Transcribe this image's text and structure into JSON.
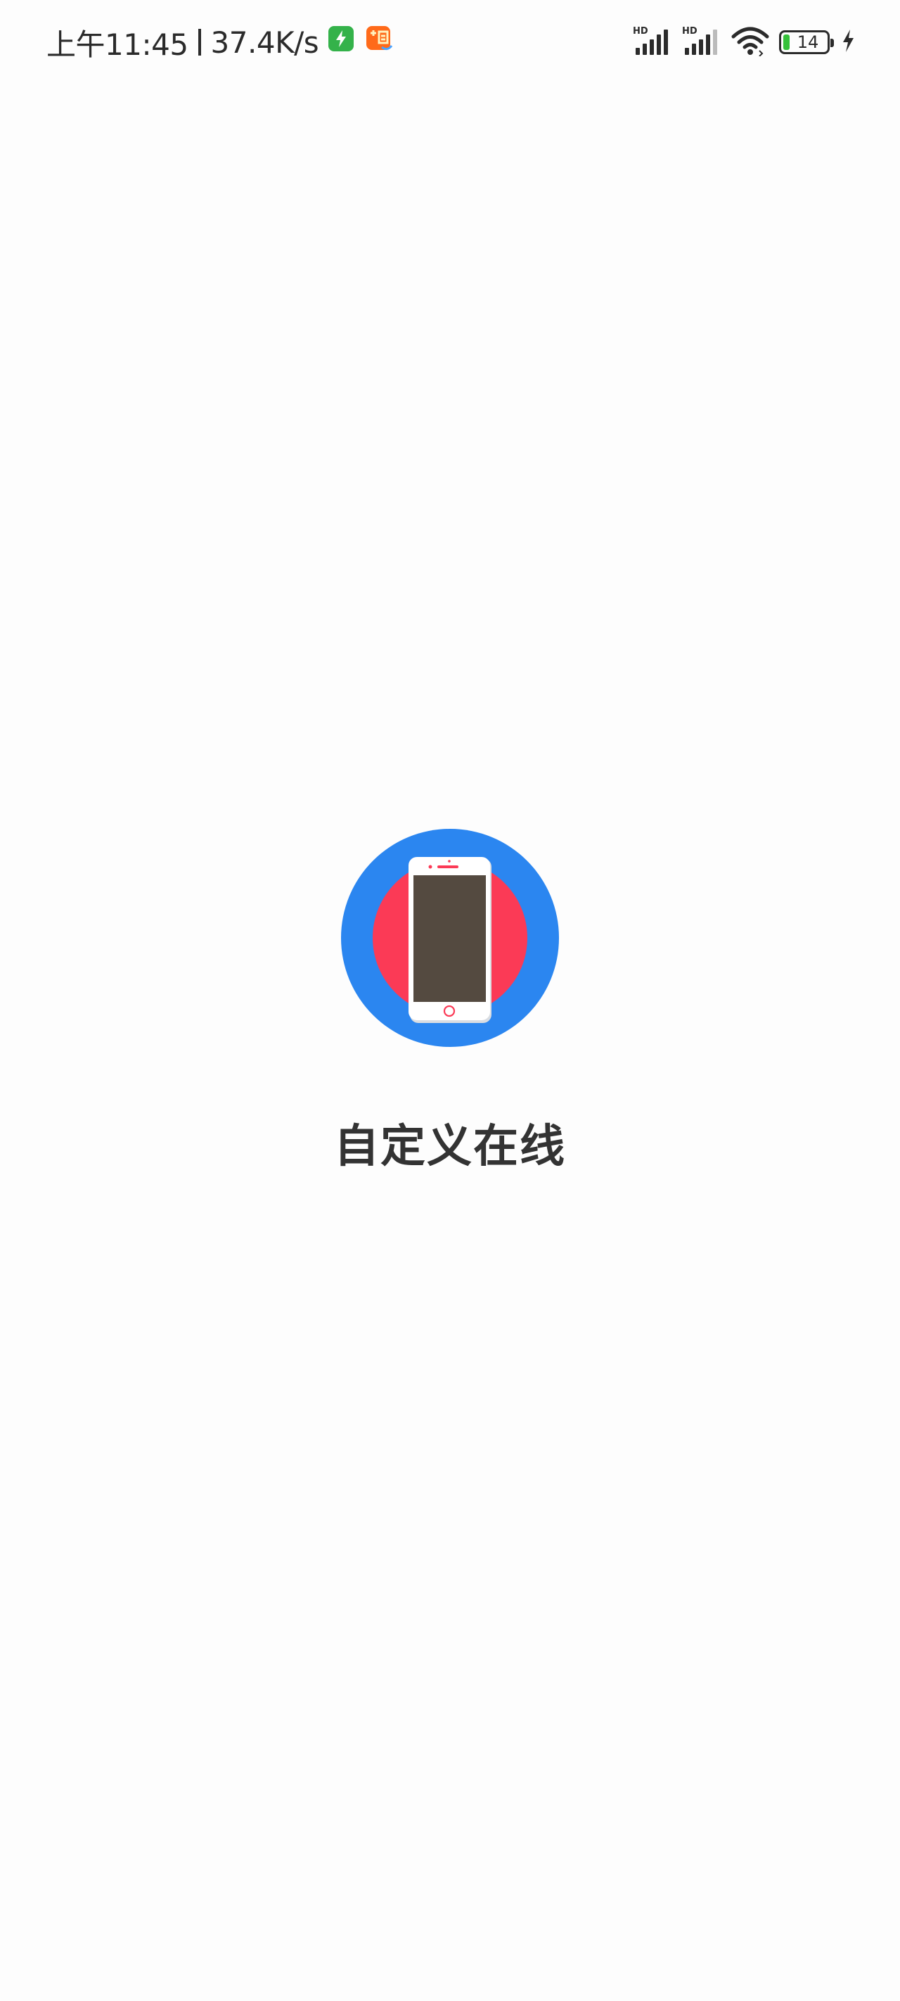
{
  "status_bar": {
    "time": "上午11:45",
    "network_speed": "37.4K/s",
    "battery_level": "14",
    "battery_fraction": 0.14,
    "notifications": [
      "charging-app-icon",
      "taobao-icon"
    ],
    "indicators": [
      "hd-signal-icon",
      "hd-signal-icon",
      "wifi-icon",
      "battery-icon",
      "charging-bolt-icon"
    ]
  },
  "splash": {
    "app_name": "自定义在线",
    "logo": "phone-logo-icon",
    "colors": {
      "outer_circle": "#2b86f0",
      "inner_circle": "#fb3a56",
      "phone_screen": "#544a40",
      "text": "#333333"
    }
  }
}
